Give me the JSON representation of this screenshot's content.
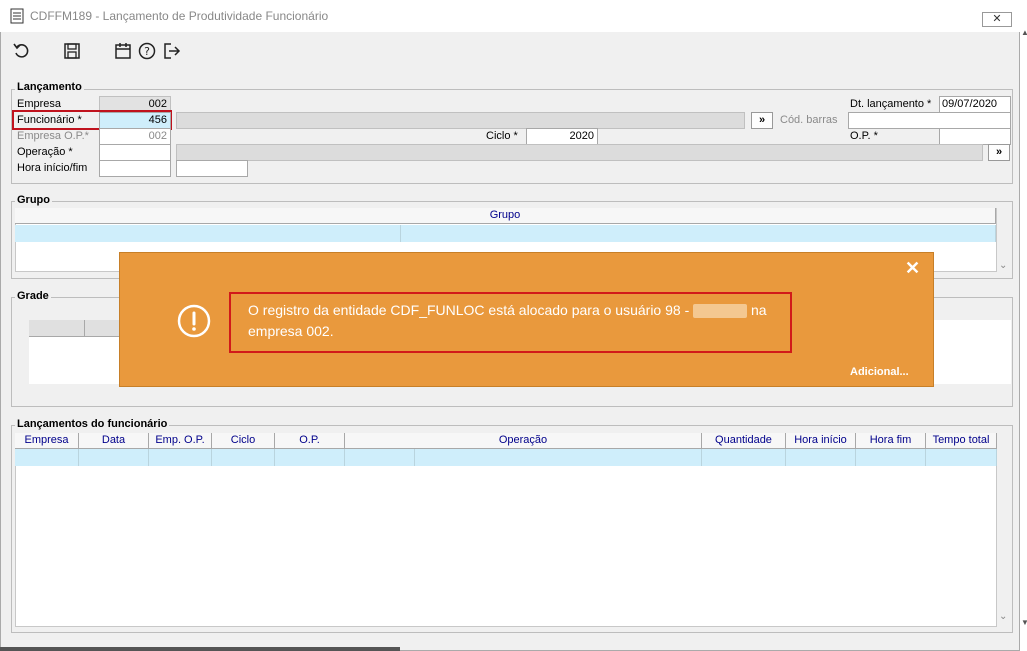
{
  "window": {
    "title": "CDFFM189 - Lançamento de Produtividade Funcionário",
    "close_label": "✕"
  },
  "toolbar": {
    "icons": [
      "undo-icon",
      "save-icon",
      "calendar-icon",
      "help-icon",
      "exit-icon"
    ]
  },
  "lancamento": {
    "section": "Lançamento",
    "empresa_label": "Empresa",
    "empresa_value": "002",
    "funcionario_label": "Funcionário *",
    "funcionario_value": "456",
    "empresa_op_label": "Empresa O.P.*",
    "empresa_op_value": "002",
    "operacao_label": "Operação *",
    "hora_label": "Hora início/fim",
    "ciclo_label": "Ciclo *",
    "ciclo_value": "2020",
    "dt_label": "Dt. lançamento *",
    "dt_value": "09/07/2020",
    "cod_barras_label": "Cód. barras",
    "op_label": "O.P. *",
    "more_label": "»"
  },
  "grupo": {
    "section": "Grupo",
    "column": "Grupo"
  },
  "grade": {
    "section": "Grade"
  },
  "lancamentos_func": {
    "section": "Lançamentos do funcionário",
    "columns": [
      "Empresa",
      "Data",
      "Emp. O.P.",
      "Ciclo",
      "O.P.",
      "Operação",
      "Quantidade",
      "Hora início",
      "Hora fim",
      "Tempo total"
    ]
  },
  "toast": {
    "message_part1": "O registro da entidade CDF_FUNLOC está alocado para o usuário 98 -",
    "message_part2": "na",
    "message_line2": "empresa 002.",
    "more_link": "Adicional...",
    "close_label": "✕",
    "color": "#e9993d"
  }
}
